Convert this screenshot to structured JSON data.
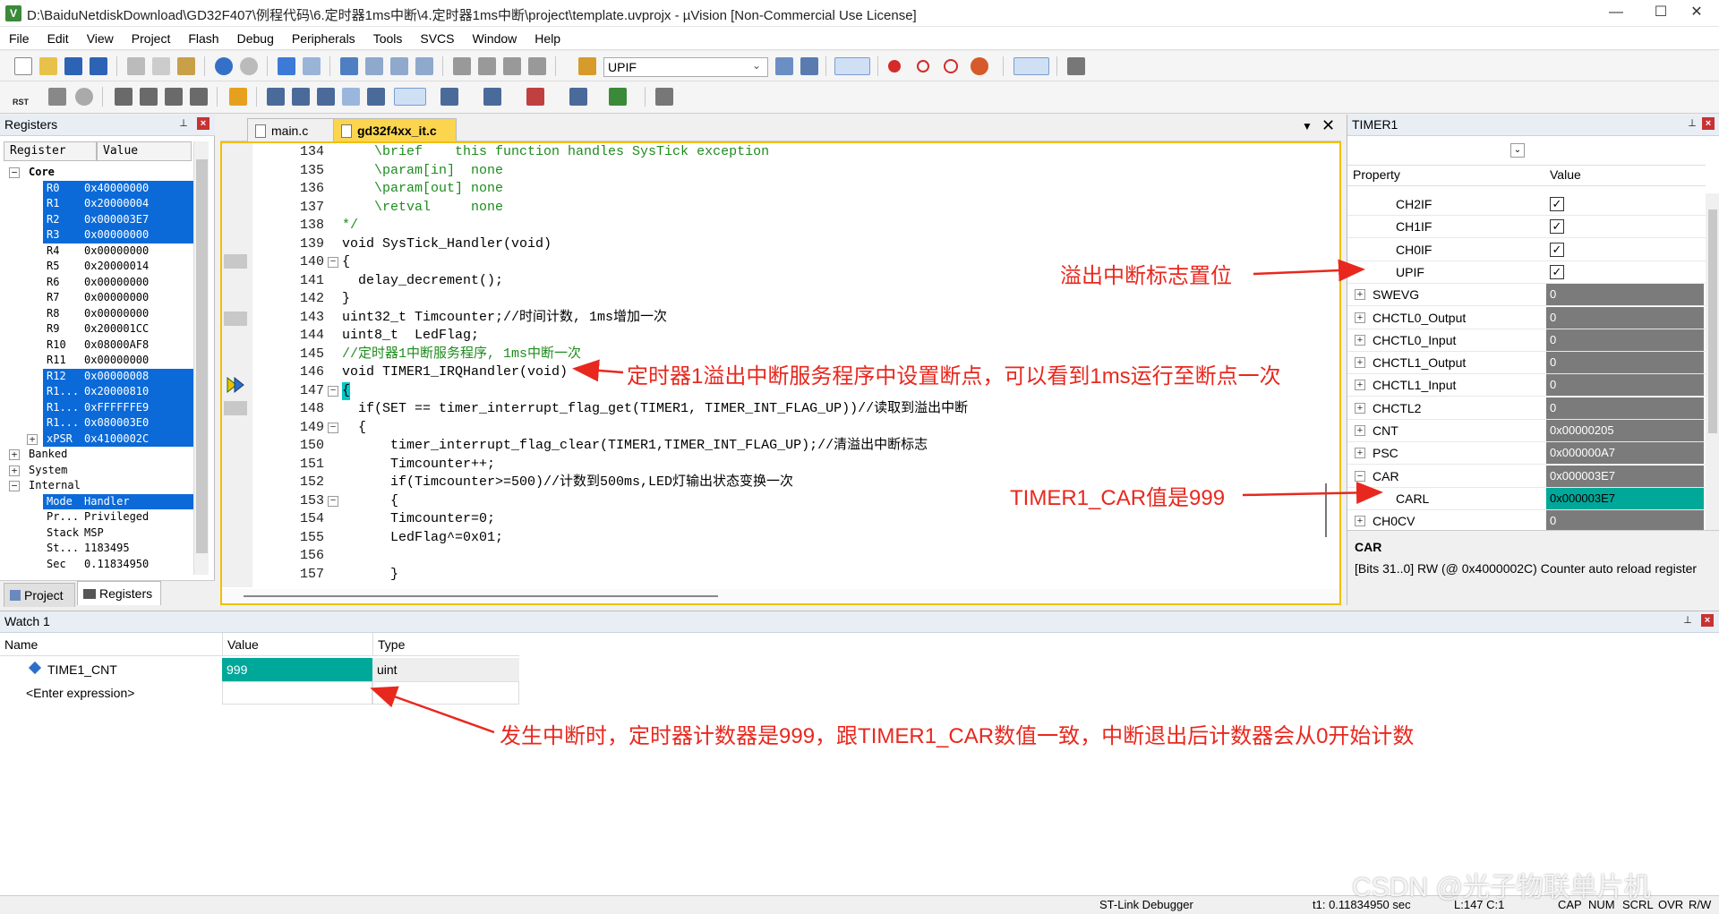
{
  "window": {
    "title": "D:\\BaiduNetdiskDownload\\GD32F407\\例程代码\\6.定时器1ms中断\\4.定时器1ms中断\\project\\template.uvprojx - µVision  [Non-Commercial Use License]",
    "app_icon": "V",
    "minimize": "—",
    "maximize": "☐",
    "close": "✕"
  },
  "menu": [
    "File",
    "Edit",
    "View",
    "Project",
    "Flash",
    "Debug",
    "Peripherals",
    "Tools",
    "SVCS",
    "Window",
    "Help"
  ],
  "toolbar": {
    "find_text": "UPIF",
    "rst_label": "RST"
  },
  "registers": {
    "title": "Registers",
    "col_register": "Register",
    "col_value": "Value",
    "rows": [
      {
        "name": "Core",
        "value": "",
        "level": 0,
        "sel": false,
        "bold": true,
        "tog": "−"
      },
      {
        "name": "R0",
        "value": "0x40000000",
        "level": 1,
        "sel": true
      },
      {
        "name": "R1",
        "value": "0x20000004",
        "level": 1,
        "sel": true
      },
      {
        "name": "R2",
        "value": "0x000003E7",
        "level": 1,
        "sel": true
      },
      {
        "name": "R3",
        "value": "0x00000000",
        "level": 1,
        "sel": true
      },
      {
        "name": "R4",
        "value": "0x00000000",
        "level": 1,
        "sel": false
      },
      {
        "name": "R5",
        "value": "0x20000014",
        "level": 1,
        "sel": false
      },
      {
        "name": "R6",
        "value": "0x00000000",
        "level": 1,
        "sel": false
      },
      {
        "name": "R7",
        "value": "0x00000000",
        "level": 1,
        "sel": false
      },
      {
        "name": "R8",
        "value": "0x00000000",
        "level": 1,
        "sel": false
      },
      {
        "name": "R9",
        "value": "0x200001CC",
        "level": 1,
        "sel": false
      },
      {
        "name": "R10",
        "value": "0x08000AF8",
        "level": 1,
        "sel": false
      },
      {
        "name": "R11",
        "value": "0x00000000",
        "level": 1,
        "sel": false
      },
      {
        "name": "R12",
        "value": "0x00000008",
        "level": 1,
        "sel": true
      },
      {
        "name": "R1...",
        "value": "0x20000810",
        "level": 1,
        "sel": true
      },
      {
        "name": "R1...",
        "value": "0xFFFFFFE9",
        "level": 1,
        "sel": true
      },
      {
        "name": "R1...",
        "value": "0x080003E0",
        "level": 1,
        "sel": true
      },
      {
        "name": "xPSR",
        "value": "0x4100002C",
        "level": 1,
        "sel": true,
        "tog": "+"
      },
      {
        "name": "Banked",
        "value": "",
        "level": 0,
        "sel": false,
        "tog": "+"
      },
      {
        "name": "System",
        "value": "",
        "level": 0,
        "sel": false,
        "tog": "+"
      },
      {
        "name": "Internal",
        "value": "",
        "level": 0,
        "sel": false,
        "tog": "−"
      },
      {
        "name": "Mode",
        "value": "Handler",
        "level": 1,
        "sel": true
      },
      {
        "name": "Pr...",
        "value": "Privileged",
        "level": 1,
        "sel": false
      },
      {
        "name": "Stack",
        "value": "MSP",
        "level": 1,
        "sel": false
      },
      {
        "name": "St...",
        "value": "1183495",
        "level": 1,
        "sel": false
      },
      {
        "name": "Sec",
        "value": "0.11834950",
        "level": 1,
        "sel": false
      }
    ],
    "tab_project": "Project",
    "tab_registers": "Registers"
  },
  "editor": {
    "tabs": [
      {
        "label": "main.c",
        "active": false
      },
      {
        "label": "gd32f4xx_it.c",
        "active": true
      }
    ],
    "lines": [
      {
        "n": "134",
        "code": "    \\brief    this function handles SysTick exception",
        "cls": "cm"
      },
      {
        "n": "135",
        "code": "    \\param[in]  none",
        "cls": "cm"
      },
      {
        "n": "136",
        "code": "    \\param[out] none",
        "cls": "cm"
      },
      {
        "n": "137",
        "code": "    \\retval     none",
        "cls": "cm"
      },
      {
        "n": "138",
        "code": "*/",
        "cls": "cm"
      },
      {
        "n": "139",
        "code": "void SysTick_Handler(void)",
        "cls": ""
      },
      {
        "n": "140",
        "code": "{",
        "cls": ""
      },
      {
        "n": "141",
        "code": "  delay_decrement();",
        "cls": ""
      },
      {
        "n": "142",
        "code": "}",
        "cls": ""
      },
      {
        "n": "143",
        "code": "uint32_t Timcounter;//时间计数, 1ms增加一次",
        "cls": ""
      },
      {
        "n": "144",
        "code": "uint8_t  LedFlag;",
        "cls": ""
      },
      {
        "n": "145",
        "code": "//定时器1中断服务程序, 1ms中断一次",
        "cls": "cm"
      },
      {
        "n": "146",
        "code": "void TIMER1_IRQHandler(void)",
        "cls": ""
      },
      {
        "n": "147",
        "code": "{",
        "cls": ""
      },
      {
        "n": "148",
        "code": "  if(SET == timer_interrupt_flag_get(TIMER1, TIMER_INT_FLAG_UP))//读取到溢出中断",
        "cls": ""
      },
      {
        "n": "149",
        "code": "  {",
        "cls": ""
      },
      {
        "n": "150",
        "code": "      timer_interrupt_flag_clear(TIMER1,TIMER_INT_FLAG_UP);//清溢出中断标志",
        "cls": ""
      },
      {
        "n": "151",
        "code": "      Timcounter++;",
        "cls": ""
      },
      {
        "n": "152",
        "code": "      if(Timcounter>=500)//计数到500ms,LED灯输出状态变换一次",
        "cls": ""
      },
      {
        "n": "153",
        "code": "      {",
        "cls": ""
      },
      {
        "n": "154",
        "code": "      Timcounter=0;",
        "cls": ""
      },
      {
        "n": "155",
        "code": "      LedFlag^=0x01;",
        "cls": ""
      },
      {
        "n": "156",
        "code": "",
        "cls": ""
      },
      {
        "n": "157",
        "code": "      }",
        "cls": ""
      }
    ]
  },
  "timer1": {
    "title": "TIMER1",
    "col_property": "Property",
    "col_value": "Value",
    "rows": [
      {
        "name": "CH2IF",
        "type": "check",
        "indent": 2
      },
      {
        "name": "CH1IF",
        "type": "check",
        "indent": 2
      },
      {
        "name": "CH0IF",
        "type": "check",
        "indent": 2
      },
      {
        "name": "UPIF",
        "type": "check",
        "indent": 2
      },
      {
        "name": "SWEVG",
        "value": "0",
        "type": "val",
        "tog": "+"
      },
      {
        "name": "CHCTL0_Output",
        "value": "0",
        "type": "val",
        "tog": "+"
      },
      {
        "name": "CHCTL0_Input",
        "value": "0",
        "type": "val",
        "tog": "+"
      },
      {
        "name": "CHCTL1_Output",
        "value": "0",
        "type": "val",
        "tog": "+"
      },
      {
        "name": "CHCTL1_Input",
        "value": "0",
        "type": "val",
        "tog": "+"
      },
      {
        "name": "CHCTL2",
        "value": "0",
        "type": "val",
        "tog": "+"
      },
      {
        "name": "CNT",
        "value": "0x00000205",
        "type": "val",
        "tog": "+"
      },
      {
        "name": "PSC",
        "value": "0x000000A7",
        "type": "val",
        "tog": "+"
      },
      {
        "name": "CAR",
        "value": "0x000003E7",
        "type": "val",
        "tog": "−"
      },
      {
        "name": "CARL",
        "value": "0x000003E7",
        "type": "hl",
        "indent": 2
      },
      {
        "name": "CH0CV",
        "value": "0",
        "type": "val",
        "tog": "+"
      }
    ],
    "desc_title": "CAR",
    "desc_text": "[Bits 31..0] RW (@ 0x4000002C) Counter auto reload register"
  },
  "watch": {
    "title": "Watch 1",
    "col_name": "Name",
    "col_value": "Value",
    "col_type": "Type",
    "rows": [
      {
        "name": "TIME1_CNT",
        "value": "999",
        "type": "uint"
      },
      {
        "name": "<Enter expression>",
        "value": "",
        "type": ""
      }
    ]
  },
  "status": {
    "debugger": "ST-Link Debugger",
    "time": "t1: 0.11834950 sec",
    "cursor": "L:147 C:1",
    "caps": "CAP",
    "num": "NUM",
    "scrl": "SCRL",
    "ovr": "OVR",
    "rw": "R/W"
  },
  "annotations": {
    "a1": "溢出中断标志置位",
    "a2": "定时器1溢出中断服务程序中设置断点，可以看到1ms运行至断点一次",
    "a3": "TIMER1_CAR值是999",
    "a4": "发生中断时，定时器计数器是999，跟TIMER1_CAR数值一致，中断退出后计数器会从0开始计数",
    "watermark": "CSDN @光子物联单片机"
  },
  "colors": {
    "accent_select": "#0b6ad8",
    "highlight_teal": "#00a89a",
    "annotation_red": "#e8281e",
    "editor_border": "#f0c000"
  }
}
